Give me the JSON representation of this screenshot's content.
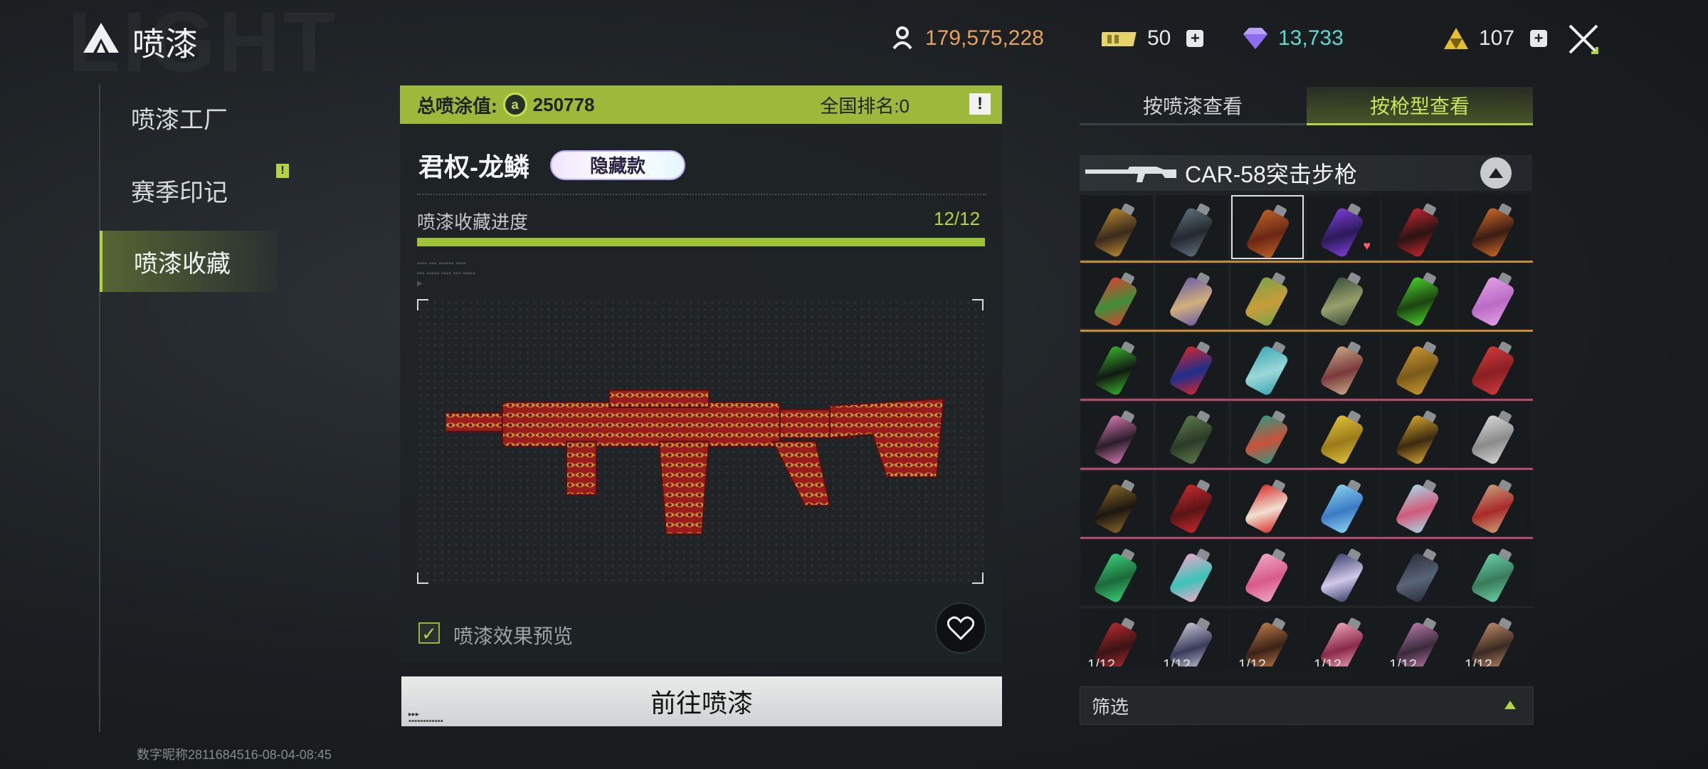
{
  "watermark": "LIGHT",
  "header": {
    "title": "喷漆",
    "currencies": [
      {
        "icon": "merit-icon",
        "value": "179,575,228",
        "color": "#e8a259"
      },
      {
        "icon": "ticket-icon",
        "value": "50",
        "color": "#f1f3f4"
      },
      {
        "icon": "diamond-icon",
        "value": "13,733",
        "color": "#5fd9cf"
      },
      {
        "icon": "triforce-icon",
        "value": "107",
        "color": "#f1f3f4"
      }
    ]
  },
  "nav": {
    "items": [
      {
        "label": "喷漆工厂"
      },
      {
        "label": "赛季印记"
      },
      {
        "label": "喷漆收藏"
      }
    ],
    "active_index": 2,
    "badge": "!"
  },
  "footer": {
    "nickname": "数字昵称2811684516-08-04-08:45"
  },
  "summary": {
    "total_label": "总喷涂值:",
    "total_value": "250778",
    "rank_label": "全国排名:0",
    "info": "!"
  },
  "item": {
    "name": "君权-龙鳞",
    "tag": "隐藏款",
    "progress_label": "喷漆收藏进度",
    "progress_text": "12/12",
    "progress_fraction": 1.0,
    "preview_checked": true,
    "preview_label": "喷漆效果预览",
    "goto_label": "前往喷漆"
  },
  "right": {
    "tabs": [
      {
        "label": "按喷漆查看"
      },
      {
        "label": "按枪型查看"
      }
    ],
    "active_tab": 1,
    "gun_name": "CAR-58突击步枪",
    "filter_label": "筛选",
    "grid_rows": [
      {
        "sep": "#c58a33",
        "cells": [
          {
            "c1": "#b8892f",
            "c2": "#3a2a1c"
          },
          {
            "c1": "#5f6f7c",
            "c2": "#23292e"
          },
          {
            "c1": "#c0602a",
            "c2": "#6b2814",
            "selected": true
          },
          {
            "c1": "#7d3fd6",
            "c2": "#2c1a5a",
            "fav": true
          },
          {
            "c1": "#c4262e",
            "c2": "#2a1414"
          },
          {
            "c1": "#d06a2a",
            "c2": "#3a1c12"
          }
        ]
      },
      {
        "sep": "#c58a33",
        "cells": [
          {
            "c1": "#d8432f",
            "c2": "#3f8f3a"
          },
          {
            "c1": "#6b5ba8",
            "c2": "#d0b07a"
          },
          {
            "c1": "#7aa34a",
            "c2": "#c99c3a"
          },
          {
            "c1": "#3c4d3a",
            "c2": "#97a06b"
          },
          {
            "c1": "#4bd22a",
            "c2": "#1c4412"
          },
          {
            "c1": "#e4a2e6",
            "c2": "#b86bc4"
          }
        ]
      },
      {
        "sep": "#b34a6a",
        "cells": [
          {
            "c1": "#39b42a",
            "c2": "#111a12"
          },
          {
            "c1": "#d7262e",
            "c2": "#1c2f8a"
          },
          {
            "c1": "#3aa7b2",
            "c2": "#9bd7d8"
          },
          {
            "c1": "#c9a98a",
            "c2": "#7a3a3a"
          },
          {
            "c1": "#c9962f",
            "c2": "#7a5a1a"
          },
          {
            "c1": "#d03a3e",
            "c2": "#8a1f22"
          }
        ]
      },
      {
        "sep": "#b34a6a",
        "cells": [
          {
            "c1": "#d97ab2",
            "c2": "#2a1e2a"
          },
          {
            "c1": "#5e7a4e",
            "c2": "#2c3a26"
          },
          {
            "c1": "#2f9a82",
            "c2": "#c9513a"
          },
          {
            "c1": "#e0c23a",
            "c2": "#9a7b1a"
          },
          {
            "c1": "#d9a62f",
            "c2": "#3a2a10"
          },
          {
            "c1": "#d8d8d8",
            "c2": "#8a8a8a"
          }
        ]
      },
      {
        "sep": "#b34a6a",
        "cells": [
          {
            "c1": "#8a6a2a",
            "c2": "#1c1610"
          },
          {
            "c1": "#c82a2e",
            "c2": "#5a1416"
          },
          {
            "c1": "#d82a2a",
            "c2": "#f0e0d0"
          },
          {
            "c1": "#8ad6f0",
            "c2": "#3a7ac4"
          },
          {
            "c1": "#a8d8e8",
            "c2": "#d05a7a"
          },
          {
            "c1": "#c9a07a",
            "c2": "#a82a2a"
          }
        ]
      },
      {
        "sep": "#23272a",
        "cells": [
          {
            "c1": "#3ad07a",
            "c2": "#1c6a3a"
          },
          {
            "c1": "#f0a8c8",
            "c2": "#3ac4b8"
          },
          {
            "c1": "#f0a8c8",
            "c2": "#d85a8a"
          },
          {
            "c1": "#3a3e6a",
            "c2": "#d0c8e8"
          },
          {
            "c1": "#2a2e3a",
            "c2": "#5a6478"
          },
          {
            "c1": "#6ad0a8",
            "c2": "#3a7a5a"
          }
        ]
      },
      {
        "sep": "#23272a",
        "cells": [
          {
            "c1": "#b82a2e",
            "c2": "#3a1416",
            "label": "1/12"
          },
          {
            "c1": "#c8c8d8",
            "c2": "#3a3a5a",
            "label": "1/12"
          },
          {
            "c1": "#c07a4a",
            "c2": "#3a2216",
            "label": "1/12"
          },
          {
            "c1": "#f0a8b8",
            "c2": "#8a2a4a",
            "label": "1/12"
          },
          {
            "c1": "#b87aa8",
            "c2": "#3a2a3a",
            "label": "1/12"
          },
          {
            "c1": "#c08a6a",
            "c2": "#3a2a22",
            "label": "1/12"
          }
        ]
      }
    ]
  }
}
